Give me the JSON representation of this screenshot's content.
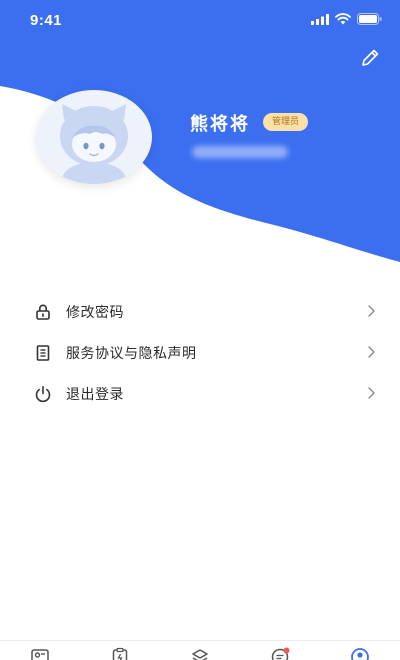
{
  "status_bar": {
    "time": "9:41"
  },
  "profile": {
    "name": "熊将将",
    "role_badge": "管理员"
  },
  "menu": {
    "items": [
      {
        "label": "修改密码",
        "icon": "lock-icon"
      },
      {
        "label": "服务协议与隐私声明",
        "icon": "document-icon"
      },
      {
        "label": "退出登录",
        "icon": "power-icon"
      }
    ]
  },
  "tabbar": {
    "tabs": [
      {
        "icon": "contacts-icon",
        "active": false
      },
      {
        "icon": "clipboard-icon",
        "active": false
      },
      {
        "icon": "layers-icon",
        "active": false
      },
      {
        "icon": "messages-icon",
        "active": false,
        "badge": true
      },
      {
        "icon": "profile-icon",
        "active": true
      }
    ]
  },
  "colors": {
    "primary": "#3b6ff0",
    "badge_bg": "#fbe1a8",
    "badge_text": "#b0711a",
    "notification_dot": "#f25a4a"
  }
}
